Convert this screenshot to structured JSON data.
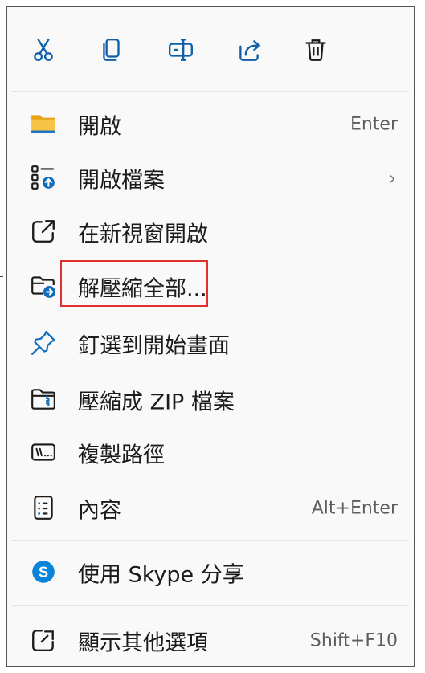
{
  "toolbar": {
    "icons": [
      "cut-icon",
      "copy-icon",
      "rename-icon",
      "share-icon",
      "delete-icon"
    ]
  },
  "items": [
    {
      "label": "開啟",
      "accel": "Enter",
      "icon": "folder-icon"
    },
    {
      "label": "開啟檔案",
      "accel": "",
      "icon": "open-with-icon",
      "submenu": "›"
    },
    {
      "label": "在新視窗開啟",
      "accel": "",
      "icon": "open-new-window-icon"
    },
    {
      "label": "解壓縮全部...",
      "accel": "",
      "icon": "extract-folder-icon"
    },
    {
      "label": "釘選到開始畫面",
      "accel": "",
      "icon": "pin-icon"
    },
    {
      "label": "壓縮成 ZIP 檔案",
      "accel": "",
      "icon": "zip-icon"
    },
    {
      "label": "複製路徑",
      "accel": "",
      "icon": "copy-path-icon"
    },
    {
      "label": "內容",
      "accel": "Alt+Enter",
      "icon": "properties-icon"
    },
    {
      "label": "使用 Skype 分享",
      "accel": "",
      "icon": "skype-icon"
    },
    {
      "label": "顯示其他選項",
      "accel": "Shift+F10",
      "icon": "more-options-icon"
    }
  ],
  "colors": {
    "accent": "#0067c0",
    "folder": "#f6c344",
    "skype": "#0a84d8",
    "highlight_border": "#e03030"
  }
}
